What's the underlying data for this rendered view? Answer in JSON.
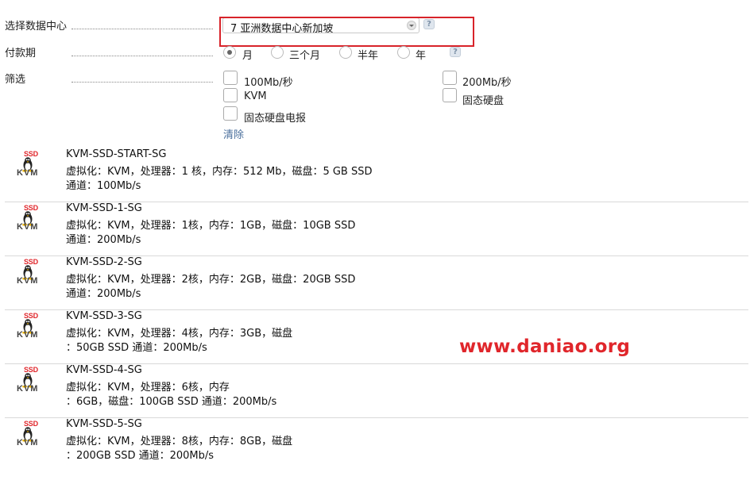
{
  "form": {
    "datacenter_label": "选择数据中心",
    "datacenter_value": "7 亚洲数据中心新加坡",
    "billing_label": "付款期",
    "billing_options": [
      "月",
      "三个月",
      "半年",
      "年"
    ],
    "billing_selected": "月",
    "filter_label": "筛选",
    "filter_options": [
      "100Mb/秒",
      "200Mb/秒",
      "KVM",
      "固态硬盘",
      "固态硬盘电报"
    ],
    "clear_label": "清除",
    "help_glyph": "?"
  },
  "logo": {
    "top_text": "SSD",
    "bottom_text": "KVM",
    "icon": "tux-linux-icon"
  },
  "products": [
    {
      "name": "KVM-SSD-START-SG",
      "line1": "虚拟化：KVM，处理器：1 核，内存：512 Mb，磁盘：5 GB SSD",
      "line2": "通道：100Mb/s"
    },
    {
      "name": "KVM-SSD-1-SG",
      "line1": "虚拟化：KVM，处理器：1核，内存：1GB，磁盘：10GB SSD",
      "line2": "通道：200Mb/s"
    },
    {
      "name": "KVM-SSD-2-SG",
      "line1": "虚拟化：KVM，处理器：2核，内存：2GB，磁盘：20GB SSD",
      "line2": "通道：200Mb/s"
    },
    {
      "name": "KVM-SSD-3-SG",
      "line1": "虚拟化：KVM，处理器：4核，内存：3GB，磁盘",
      "line2": "：50GB SSD 通道：200Mb/s"
    },
    {
      "name": "KVM-SSD-4-SG",
      "line1": "虚拟化：KVM，处理器：6核，内存",
      "line2": "：6GB，磁盘：100GB SSD 通道：200Mb/s"
    },
    {
      "name": "KVM-SSD-5-SG",
      "line1": "虚拟化：KVM，处理器：8核，内存：8GB，磁盘",
      "line2": "：200GB SSD 通道：200Mb/s"
    }
  ],
  "watermark": "www.daniao.org",
  "colors": {
    "highlight": "#d8232a",
    "link": "#4a6f9c",
    "ssd_red": "#e0262b"
  }
}
